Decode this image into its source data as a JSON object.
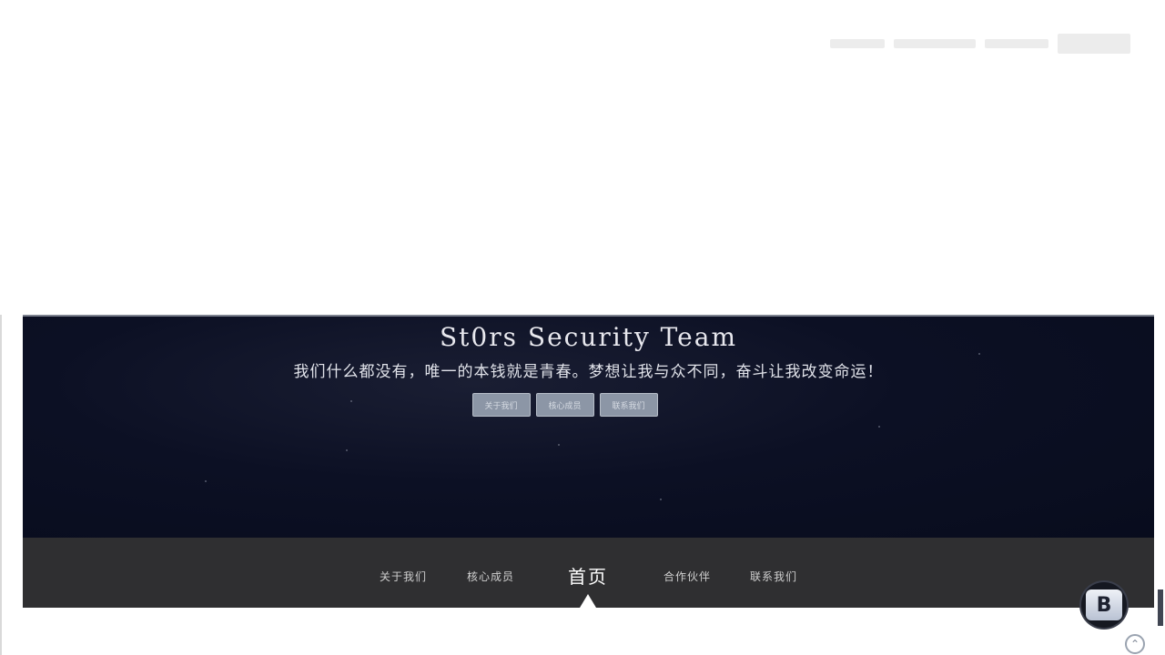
{
  "hero": {
    "title": "St0rs Security Team",
    "slogan": "我们什么都没有，唯一的本钱就是青春。梦想让我与众不同，奋斗让我改变命运！",
    "buttons": [
      "关于我们",
      "核心成员",
      "联系我们"
    ]
  },
  "nav": {
    "items": [
      {
        "label": "关于我们",
        "active": false
      },
      {
        "label": "核心成员",
        "active": false
      },
      {
        "label": "首页",
        "active": true
      },
      {
        "label": "合作伙伴",
        "active": false
      },
      {
        "label": "联系我们",
        "active": false
      }
    ]
  },
  "badge": {
    "glyph": "B"
  },
  "to_top": {
    "glyph": "⌃"
  },
  "colors": {
    "hero_bg": "#0c1024",
    "nav_bg": "#2f2f31",
    "button_bg": "#8c96a6"
  }
}
